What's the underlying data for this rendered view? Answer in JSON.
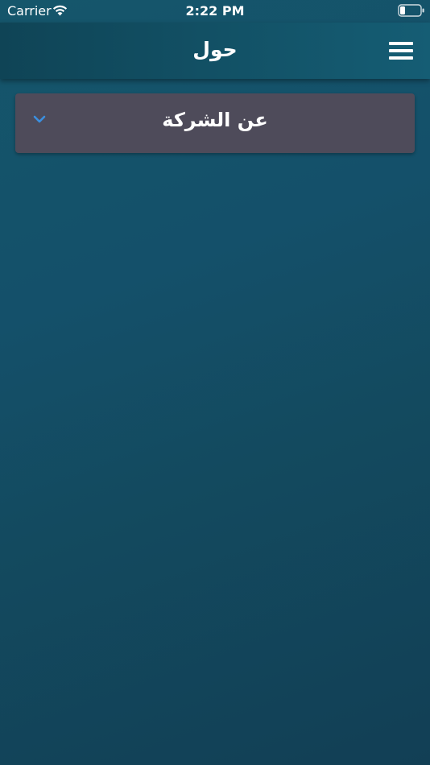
{
  "status_bar": {
    "carrier": "Carrier",
    "time": "2:22 PM",
    "wifi_icon": "wifi-icon",
    "battery_icon": "battery-icon"
  },
  "header": {
    "title": "حول",
    "menu_icon": "hamburger-menu-icon"
  },
  "accordion": {
    "title": "عن الشركة",
    "expanded": false,
    "chevron_icon": "chevron-down-icon",
    "chevron_color": "#3b8fe0"
  },
  "colors": {
    "background_top": "#15566b",
    "background_bottom": "#123f55",
    "header_left": "#0f4456",
    "header_right": "#155d74",
    "card": "#4e4b5a",
    "text": "#ffffff"
  }
}
